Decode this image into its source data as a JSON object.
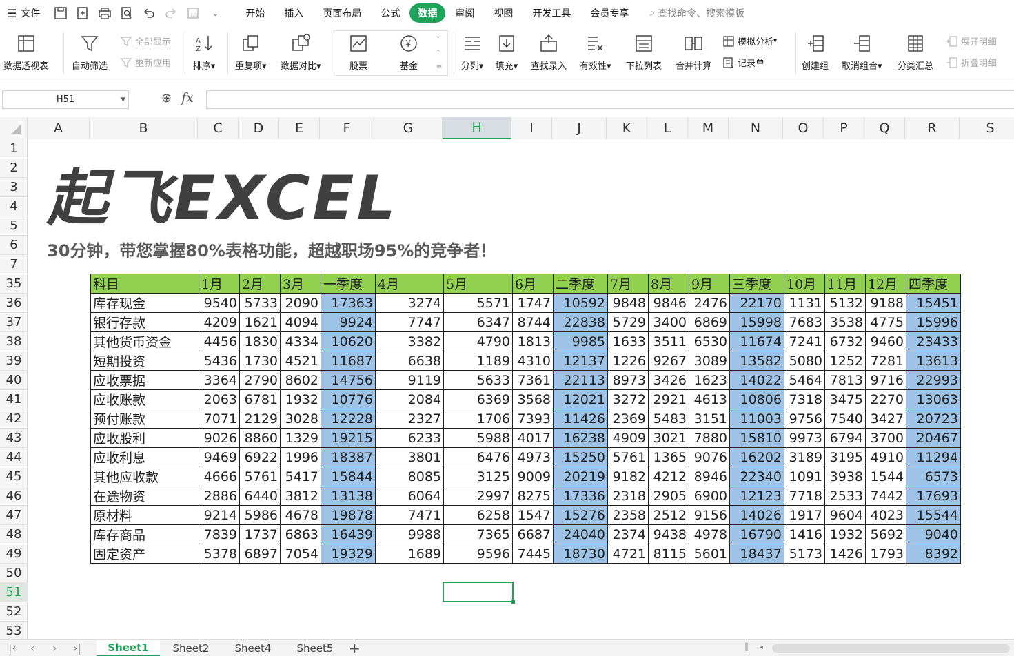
{
  "menubar": {
    "file_label": "文件",
    "tabs": [
      "开始",
      "插入",
      "页面布局",
      "公式",
      "数据",
      "审阅",
      "视图",
      "开发工具",
      "会员专享"
    ],
    "active_tab": "数据",
    "search_placeholder": "查找命令、搜索模板"
  },
  "ribbon": {
    "pivot": "数据透视表",
    "autofilter": "自动筛选",
    "show_all": "全部显示",
    "reapply": "重新应用",
    "sort": "排序",
    "duplicates": "重复项",
    "compare": "数据对比",
    "stocks": "股票",
    "funds": "基金",
    "split": "分列",
    "fill": "填充",
    "lookup": "查找录入",
    "validity": "有效性",
    "dropdown": "下拉列表",
    "consolidate": "合并计算",
    "whatif": "模拟分析",
    "form": "记录单",
    "group": "创建组",
    "ungroup": "取消组合",
    "subtotal": "分类汇总",
    "expand": "展开明细",
    "collapse": "折叠明细"
  },
  "formula_bar": {
    "cell_ref": "H51",
    "fx": "fx",
    "formula": ""
  },
  "columns": [
    "A",
    "B",
    "C",
    "D",
    "E",
    "F",
    "G",
    "H",
    "I",
    "J",
    "K",
    "L",
    "M",
    "N",
    "O",
    "P",
    "Q",
    "R",
    "S"
  ],
  "selected_column": "H",
  "rows": [
    "1",
    "2",
    "3",
    "4",
    "5",
    "6",
    "7",
    "35",
    "36",
    "37",
    "38",
    "39",
    "40",
    "41",
    "42",
    "43",
    "44",
    "45",
    "46",
    "47",
    "48",
    "49",
    "50",
    "51",
    "52",
    "53"
  ],
  "selected_row": "51",
  "banner": {
    "logo": "起飞EXCEL",
    "subtitle": "30分钟，带您掌握80%表格功能，超越职场95%的竞争者！"
  },
  "table": {
    "headers": [
      "科目",
      "1月",
      "2月",
      "3月",
      "一季度",
      "4月",
      "5月",
      "6月",
      "二季度",
      "7月",
      "8月",
      "9月",
      "三季度",
      "10月",
      "11月",
      "12月",
      "四季度"
    ],
    "quarter_columns": [
      4,
      8,
      12,
      16
    ],
    "rows": [
      [
        "库存现金",
        "9540",
        "5733",
        "2090",
        "17363",
        "3274",
        "5571",
        "1747",
        "10592",
        "9848",
        "9846",
        "2476",
        "22170",
        "1131",
        "5132",
        "9188",
        "15451"
      ],
      [
        "银行存款",
        "4209",
        "1621",
        "4094",
        "9924",
        "7747",
        "6347",
        "8744",
        "22838",
        "5729",
        "3400",
        "6869",
        "15998",
        "7683",
        "3538",
        "4775",
        "15996"
      ],
      [
        "其他货币资金",
        "4456",
        "1830",
        "4334",
        "10620",
        "3382",
        "4790",
        "1813",
        "9985",
        "1633",
        "3511",
        "6530",
        "11674",
        "7241",
        "6732",
        "9460",
        "23433"
      ],
      [
        "短期投资",
        "5436",
        "1730",
        "4521",
        "11687",
        "6638",
        "1189",
        "4310",
        "12137",
        "1226",
        "9267",
        "3089",
        "13582",
        "5080",
        "1252",
        "7281",
        "13613"
      ],
      [
        "应收票据",
        "3364",
        "2790",
        "8602",
        "14756",
        "9119",
        "5633",
        "7361",
        "22113",
        "8973",
        "3426",
        "1623",
        "14022",
        "5464",
        "7813",
        "9716",
        "22993"
      ],
      [
        "应收账款",
        "2063",
        "6781",
        "1932",
        "10776",
        "2084",
        "6369",
        "3568",
        "12021",
        "3272",
        "2921",
        "4613",
        "10806",
        "7318",
        "3475",
        "2270",
        "13063"
      ],
      [
        "预付账款",
        "7071",
        "2129",
        "3028",
        "12228",
        "2327",
        "1706",
        "7393",
        "11426",
        "2369",
        "5483",
        "3151",
        "11003",
        "9756",
        "7540",
        "3427",
        "20723"
      ],
      [
        "应收股利",
        "9026",
        "8860",
        "1329",
        "19215",
        "6233",
        "5988",
        "4017",
        "16238",
        "4909",
        "3021",
        "7880",
        "15810",
        "9973",
        "6794",
        "3700",
        "20467"
      ],
      [
        "应收利息",
        "9469",
        "6922",
        "1996",
        "18387",
        "3801",
        "6476",
        "4973",
        "15250",
        "5761",
        "1365",
        "9076",
        "16202",
        "3189",
        "3195",
        "4910",
        "11294"
      ],
      [
        "其他应收款",
        "4666",
        "5761",
        "5417",
        "15844",
        "8085",
        "3125",
        "9009",
        "20219",
        "9182",
        "4212",
        "8946",
        "22340",
        "1091",
        "3938",
        "1544",
        "6573"
      ],
      [
        "在途物资",
        "2886",
        "6440",
        "3812",
        "13138",
        "6064",
        "2997",
        "8275",
        "17336",
        "2318",
        "2905",
        "6900",
        "12123",
        "7718",
        "2533",
        "7442",
        "17693"
      ],
      [
        "原材料",
        "9214",
        "5986",
        "4678",
        "19878",
        "7471",
        "6258",
        "1547",
        "15276",
        "2358",
        "2512",
        "9156",
        "14026",
        "1917",
        "9604",
        "4023",
        "15544"
      ],
      [
        "库存商品",
        "7839",
        "1737",
        "6863",
        "16439",
        "9988",
        "7365",
        "6687",
        "24040",
        "2374",
        "9438",
        "4978",
        "16790",
        "1416",
        "1932",
        "5692",
        "9040"
      ],
      [
        "固定资产",
        "5378",
        "6897",
        "7054",
        "19329",
        "1689",
        "9596",
        "7445",
        "18730",
        "4721",
        "8115",
        "5601",
        "18437",
        "5173",
        "1426",
        "1793",
        "8392"
      ]
    ]
  },
  "sheets": [
    "Sheet1",
    "Sheet2",
    "Sheet4",
    "Sheet5"
  ],
  "active_sheet": "Sheet1",
  "colors": {
    "accent": "#1fa35b",
    "header_fill": "#92d050",
    "quarter_fill": "#9dc3e6"
  }
}
